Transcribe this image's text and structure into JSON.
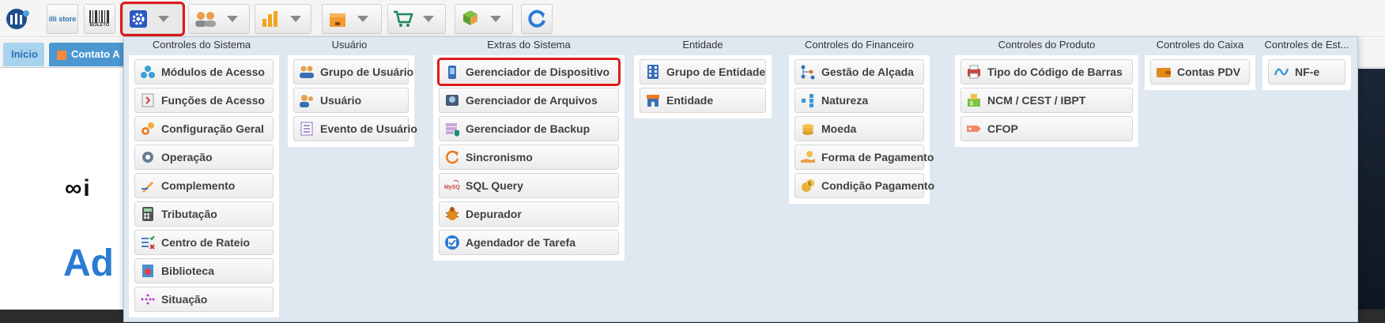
{
  "toolbar": {
    "logo_icon": "illi-logo-icon",
    "store_label": "illi store",
    "boleto_label": "BOLETO",
    "buttons": [
      {
        "icon": "gear-icon",
        "active": true
      },
      {
        "icon": "users-icon"
      },
      {
        "icon": "bar-chart-icon"
      },
      {
        "icon": "box-icon"
      },
      {
        "icon": "cart-icon"
      },
      {
        "icon": "package-hand-icon"
      },
      {
        "icon": "refresh-icon"
      }
    ]
  },
  "tabs": [
    {
      "label": "Inicio"
    },
    {
      "label": "Contato A"
    }
  ],
  "background": {
    "brand_text": "∞i",
    "big_text": "Ad"
  },
  "menu": {
    "columns": [
      {
        "title": "Controles do Sistema",
        "items": [
          "Módulos de Acesso",
          "Funções de Acesso",
          "Configuração Geral",
          "Operação",
          "Complemento",
          "Tributação",
          "Centro de Rateio",
          "Biblioteca",
          "Situação"
        ]
      },
      {
        "title": "Usuário",
        "items": [
          "Grupo de Usuário",
          "Usuário",
          "Evento de Usuário"
        ]
      },
      {
        "title": "Extras do Sistema",
        "items": [
          "Gerenciador de Dispositivo",
          "Gerenciador de Arquivos",
          "Gerenciador de Backup",
          "Sincronismo",
          "SQL Query",
          "Depurador",
          "Agendador de Tarefa"
        ]
      },
      {
        "title": "Entidade",
        "items": [
          "Grupo de Entidade",
          "Entidade"
        ]
      },
      {
        "title": "Controles do Financeiro",
        "items": [
          "Gestão de Alçada",
          "Natureza",
          "Moeda",
          "Forma de Pagamento",
          "Condição Pagamento"
        ]
      },
      {
        "title": "Controles do Produto",
        "items": [
          "Tipo do Código de Barras",
          "NCM / CEST / IBPT",
          "CFOP"
        ]
      },
      {
        "title": "Controles do Caixa",
        "items": [
          "Contas PDV"
        ]
      },
      {
        "title": "Controles de Est...",
        "items": [
          "NF-e"
        ]
      }
    ]
  }
}
